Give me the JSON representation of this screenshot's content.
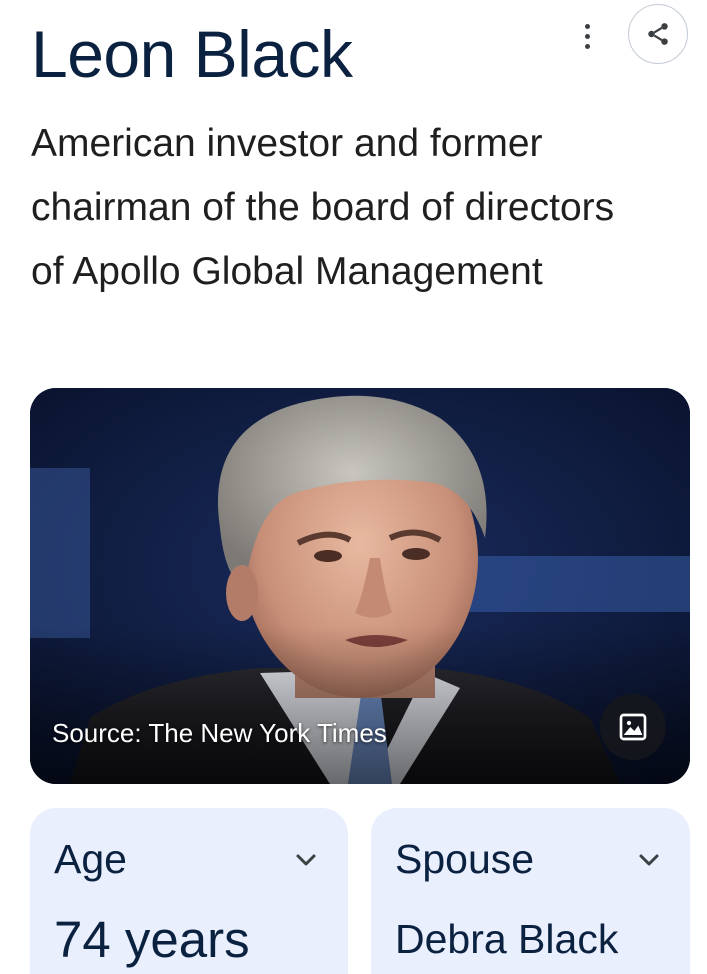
{
  "header": {
    "title": "Leon Black",
    "more_icon": "more-vert-icon",
    "share_icon": "share-icon"
  },
  "description": "American investor and former chairman of the board of directors of Apollo Global Management",
  "hero_image": {
    "caption": "Source: The New York Times",
    "image_icon": "image-icon"
  },
  "facts": {
    "age": {
      "label": "Age",
      "value": "74 years",
      "icon": "chevron-down-icon"
    },
    "spouse": {
      "label": "Spouse",
      "value": "Debra Black",
      "icon": "chevron-down-icon"
    }
  },
  "colors": {
    "title": "#0b2140",
    "card_bg": "#e9effd",
    "hero_bg": "#0d1a3a"
  }
}
